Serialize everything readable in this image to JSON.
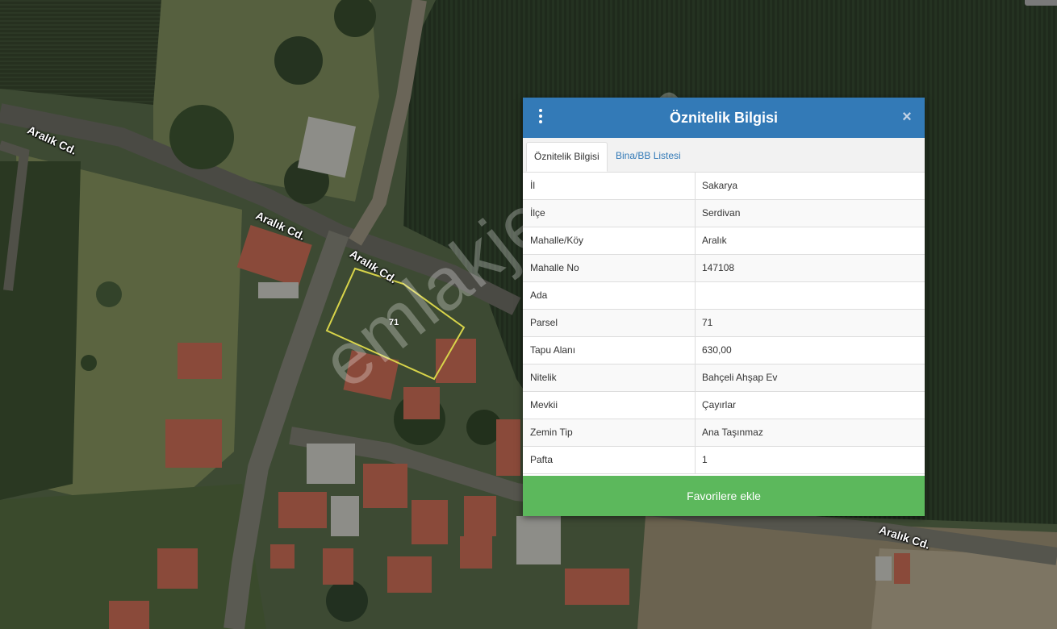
{
  "map": {
    "road_labels": [
      "Aralık Cd.",
      "Aralık Cd.",
      "Aralık Cd.",
      "Aralık Cd."
    ],
    "parcel_number": "71",
    "watermark": "emlakjet.com"
  },
  "panel": {
    "title": "Öznitelik Bilgisi",
    "menu_icon": "vertical-ellipsis",
    "close_icon": "×",
    "tabs": [
      {
        "label": "Öznitelik Bilgisi",
        "active": true
      },
      {
        "label": "Bina/BB Listesi",
        "active": false
      }
    ],
    "rows": [
      {
        "key": "İl",
        "value": "Sakarya"
      },
      {
        "key": "İlçe",
        "value": "Serdivan"
      },
      {
        "key": "Mahalle/Köy",
        "value": "Aralık"
      },
      {
        "key": "Mahalle No",
        "value": "147108"
      },
      {
        "key": "Ada",
        "value": ""
      },
      {
        "key": "Parsel",
        "value": "71"
      },
      {
        "key": "Tapu Alanı",
        "value": "630,00"
      },
      {
        "key": "Nitelik",
        "value": "Bahçeli Ahşap Ev"
      },
      {
        "key": "Mevkii",
        "value": "Çayırlar"
      },
      {
        "key": "Zemin Tip",
        "value": "Ana Taşınmaz"
      },
      {
        "key": "Pafta",
        "value": "1"
      }
    ],
    "favorite_button": "Favorilere ekle"
  },
  "colors": {
    "header": "#337ab7",
    "button": "#5cb85c",
    "parcel_outline": "#d8d44a"
  }
}
